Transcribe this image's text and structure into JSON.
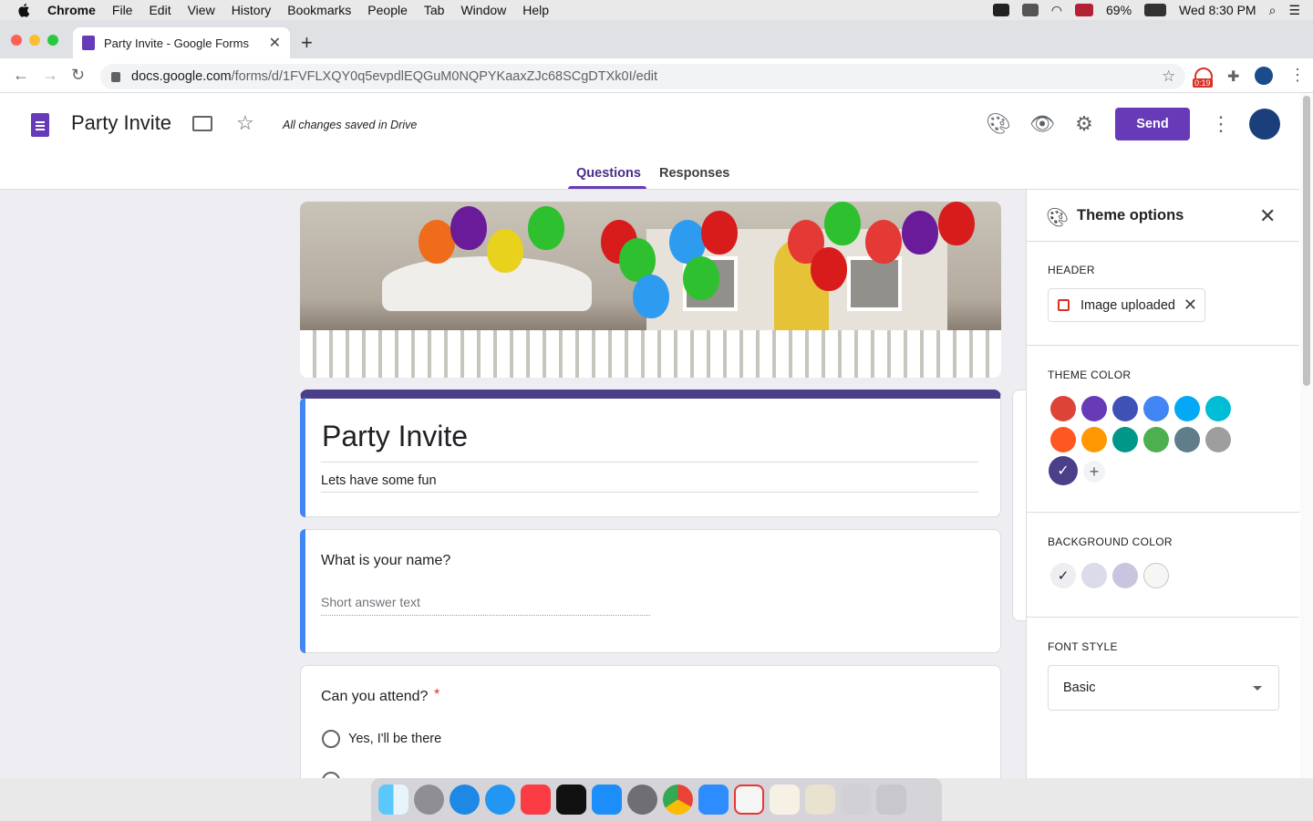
{
  "menubar": {
    "app": "Chrome",
    "items": [
      "File",
      "Edit",
      "View",
      "History",
      "Bookmarks",
      "People",
      "Tab",
      "Window",
      "Help"
    ],
    "battery": "69%",
    "clock": "Wed 8:30 PM"
  },
  "browser": {
    "tab_title": "Party Invite - Google Forms",
    "tab_close": "✕",
    "new_tab": "+",
    "url_domain": "docs.google.com",
    "url_path": "/forms/d/1FVFLXQY0q5evpdlEQGuM0NQPYKaaxZJc68SCgDTXk0I/edit",
    "extension_badge": "0:19"
  },
  "header": {
    "doc_title": "Party Invite",
    "save_status": "All changes saved in Drive",
    "send_label": "Send",
    "tabs": [
      "Questions",
      "Responses"
    ]
  },
  "form": {
    "title": "Party Invite",
    "description": "Lets have some fun",
    "questions": [
      {
        "title": "What is your name?",
        "placeholder": "Short answer text"
      },
      {
        "title": "Can you attend?",
        "required_mark": "*",
        "options": [
          "Yes,  I'll be there"
        ]
      }
    ]
  },
  "theme_panel": {
    "title": "Theme options",
    "header_label": "HEADER",
    "header_chip": "Image uploaded",
    "theme_color_label": "THEME COLOR",
    "theme_colors": [
      "#db4437",
      "#673ab7",
      "#3f51b5",
      "#4285f4",
      "#03a9f4",
      "#00bcd4",
      "#ff5722",
      "#ff9800",
      "#009688",
      "#4caf50",
      "#607d8b",
      "#9e9e9e",
      "#4a3f88"
    ],
    "background_color_label": "BACKGROUND COLOR",
    "background_colors": [
      "#ededf2",
      "#dcdbe9",
      "#c9c5df",
      "#f6f6f6"
    ],
    "font_style_label": "FONT STYLE",
    "font_style_value": "Basic"
  },
  "colors": {
    "accent": "#673ab7",
    "theme_selected": "#4a3f88"
  }
}
